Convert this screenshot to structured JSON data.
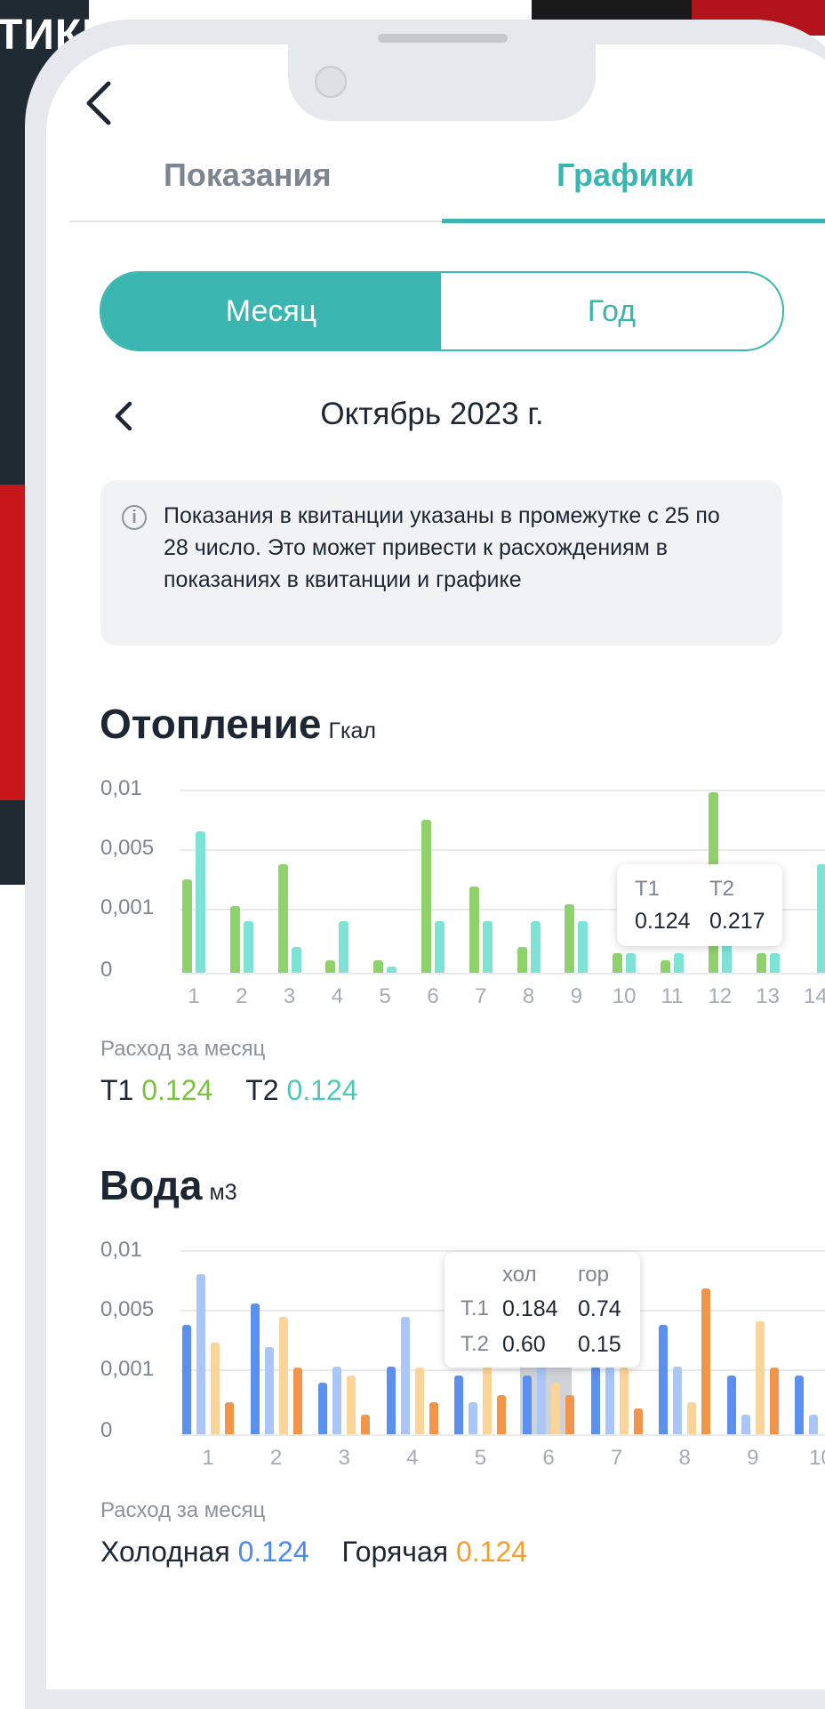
{
  "corner_text": "ТИКИ",
  "tabs": {
    "readings": "Показания",
    "charts": "Графики"
  },
  "period_toggle": {
    "month": "Месяц",
    "year": "Год"
  },
  "month_title": "Октябрь 2023 г.",
  "info_text": "Показания в квитанции указаны в промежутке с 25 по 28 число. Это может привести к расхождениям в показаниях в квитанции и графике",
  "colors": {
    "accent": "#3ab5b0",
    "t1": "#8fd16a",
    "t2": "#7ee3d4",
    "cold_t1": "#5b8ff0",
    "cold_t2": "#aac5f7",
    "hot_t1": "#fbd49a",
    "hot_t2": "#f2954a"
  },
  "heating": {
    "title": "Отопление",
    "unit": "Гкал",
    "y_ticks": [
      "0,01",
      "0,005",
      "0,001",
      "0"
    ],
    "tooltip": {
      "h1": "Т1",
      "h2": "Т2",
      "v1": "0.124",
      "v2": "0.217"
    },
    "consumption_label": "Расход за месяц",
    "t1_label": "Т1",
    "t1_value": "0.124",
    "t2_label": "Т2",
    "t2_value": "0.124"
  },
  "water": {
    "title": "Вода",
    "unit": "м3",
    "y_ticks": [
      "0,01",
      "0,005",
      "0,001",
      "0"
    ],
    "tooltip": {
      "h1": "хол",
      "h2": "гор",
      "r1": "Т.1",
      "r1v1": "0.184",
      "r1v2": "0.74",
      "r2": "Т.2",
      "r2v1": "0.60",
      "r2v2": "0.15"
    },
    "consumption_label": "Расход за месяц",
    "cold_label": "Холодная",
    "cold_value": "0.124",
    "hot_label": "Горячая",
    "hot_value": "0.124"
  },
  "chart_data": [
    {
      "type": "bar",
      "title": "Отопление",
      "ylabel": "Гкал",
      "y_ticks": [
        "0",
        "0,001",
        "0,005",
        "0,01"
      ],
      "categories": [
        "1",
        "2",
        "3",
        "4",
        "5",
        "6",
        "7",
        "8",
        "9",
        "10",
        "11",
        "12",
        "13",
        "14"
      ],
      "series": [
        {
          "name": "Т1",
          "values": [
            0.003,
            0.0012,
            0.004,
            0.0002,
            0.0002,
            0.0075,
            0.0025,
            0.0004,
            0.0013,
            0.0003,
            0.0002,
            0.0098,
            0.0003,
            0
          ]
        },
        {
          "name": "Т2",
          "values": [
            0.0065,
            0.0008,
            0.0004,
            0.0008,
            0.0001,
            0.0008,
            0.0008,
            0.0008,
            0.0008,
            0.0003,
            0.0003,
            0.004,
            0.0003,
            0.004
          ]
        }
      ]
    },
    {
      "type": "bar",
      "title": "Вода",
      "ylabel": "м3",
      "y_ticks": [
        "0",
        "0,001",
        "0,005",
        "0,01"
      ],
      "categories": [
        "1",
        "2",
        "3",
        "4",
        "5",
        "6",
        "7",
        "8",
        "9",
        "10"
      ],
      "series": [
        {
          "name": "хол Т.1",
          "values": [
            0.004,
            0.0055,
            0.0008,
            0.0012,
            0.0009,
            0.0009,
            0.0012,
            0.004,
            0.0009,
            0.0009
          ]
        },
        {
          "name": "хол Т.2",
          "values": [
            0.008,
            0.0025,
            0.0012,
            0.0045,
            0.0005,
            0.0012,
            0.0012,
            0.0012,
            0.0003,
            0.0003
          ]
        },
        {
          "name": "гор Т.1",
          "values": [
            0.0028,
            0.0045,
            0.0009,
            0.0011,
            0.0012,
            0.0008,
            0.0011,
            0.0005,
            0.0042,
            0
          ]
        },
        {
          "name": "гор Т.2",
          "values": [
            0.0005,
            0.0011,
            0.0003,
            0.0005,
            0.0006,
            0.0006,
            0.0004,
            0.0068,
            0.0011,
            0
          ]
        }
      ]
    }
  ]
}
